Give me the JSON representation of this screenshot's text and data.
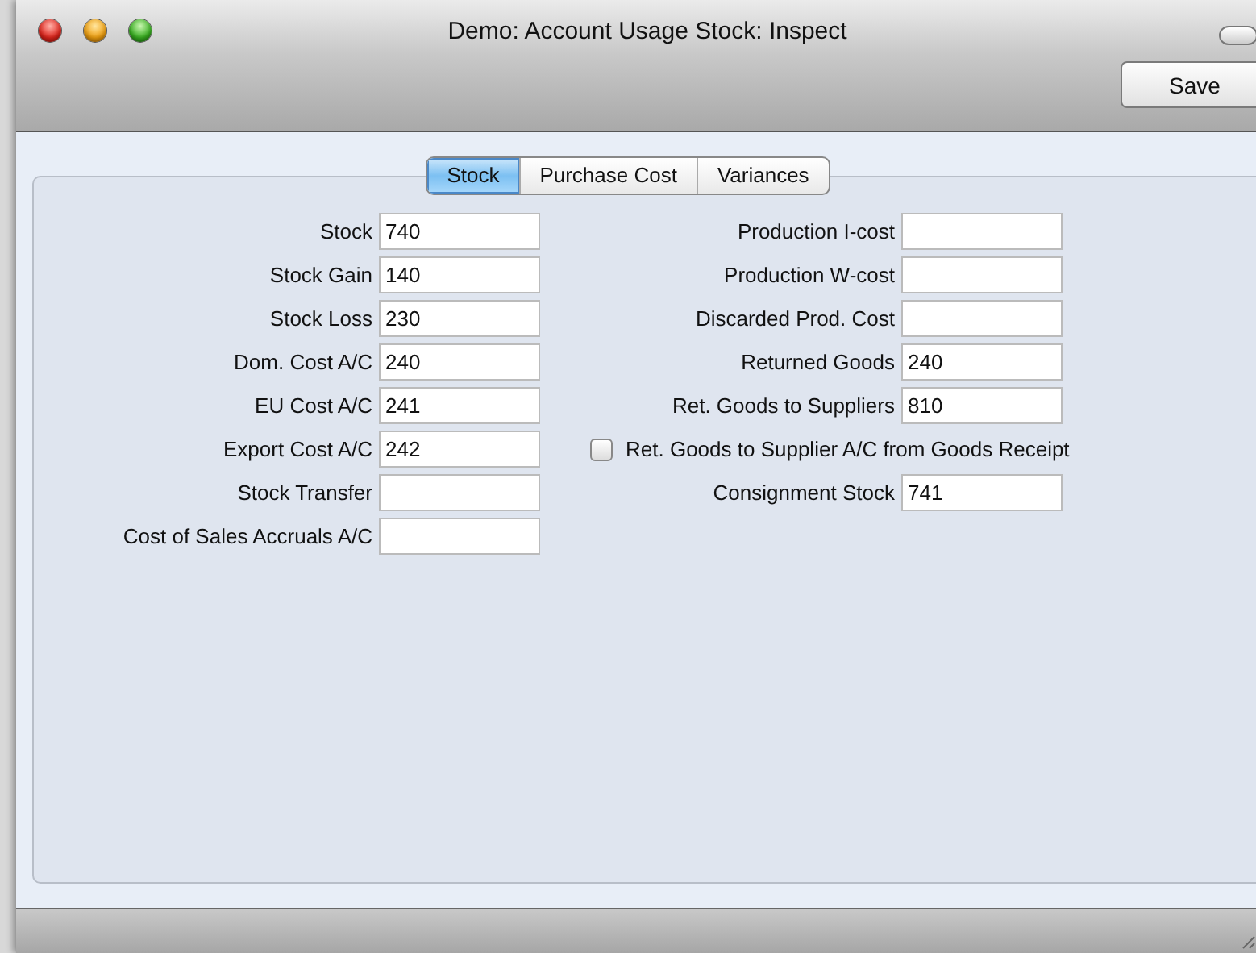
{
  "window": {
    "title": "Demo: Account Usage Stock: Inspect"
  },
  "toolbar": {
    "buttons": [
      "Save"
    ]
  },
  "tabs": [
    {
      "label": "Stock",
      "selected": true
    },
    {
      "label": "Purchase Cost",
      "selected": false
    },
    {
      "label": "Variances",
      "selected": false
    }
  ],
  "left_fields": [
    {
      "label": "Stock",
      "value": "740"
    },
    {
      "label": "Stock Gain",
      "value": "140"
    },
    {
      "label": "Stock Loss",
      "value": "230"
    },
    {
      "label": "Dom. Cost A/C",
      "value": "240"
    },
    {
      "label": "EU Cost A/C",
      "value": "241"
    },
    {
      "label": "Export Cost A/C",
      "value": "242"
    },
    {
      "label": "Stock Transfer"
    },
    {
      "label": "Cost of Sales Accruals A/C"
    }
  ],
  "right_fields": [
    {
      "kind": "field",
      "label": "Production I-cost"
    },
    {
      "kind": "field",
      "label": "Production W-cost"
    },
    {
      "kind": "field",
      "label": "Discarded Prod. Cost"
    },
    {
      "kind": "field",
      "label": "Returned Goods",
      "value": "240"
    },
    {
      "kind": "field",
      "label": "Ret. Goods to Suppliers",
      "value": "810"
    },
    {
      "kind": "checkbox",
      "label": "Ret. Goods to Supplier A/C from Goods Receipt",
      "checked": false
    },
    {
      "kind": "field",
      "label": "Consignment Stock",
      "value": "741"
    }
  ]
}
